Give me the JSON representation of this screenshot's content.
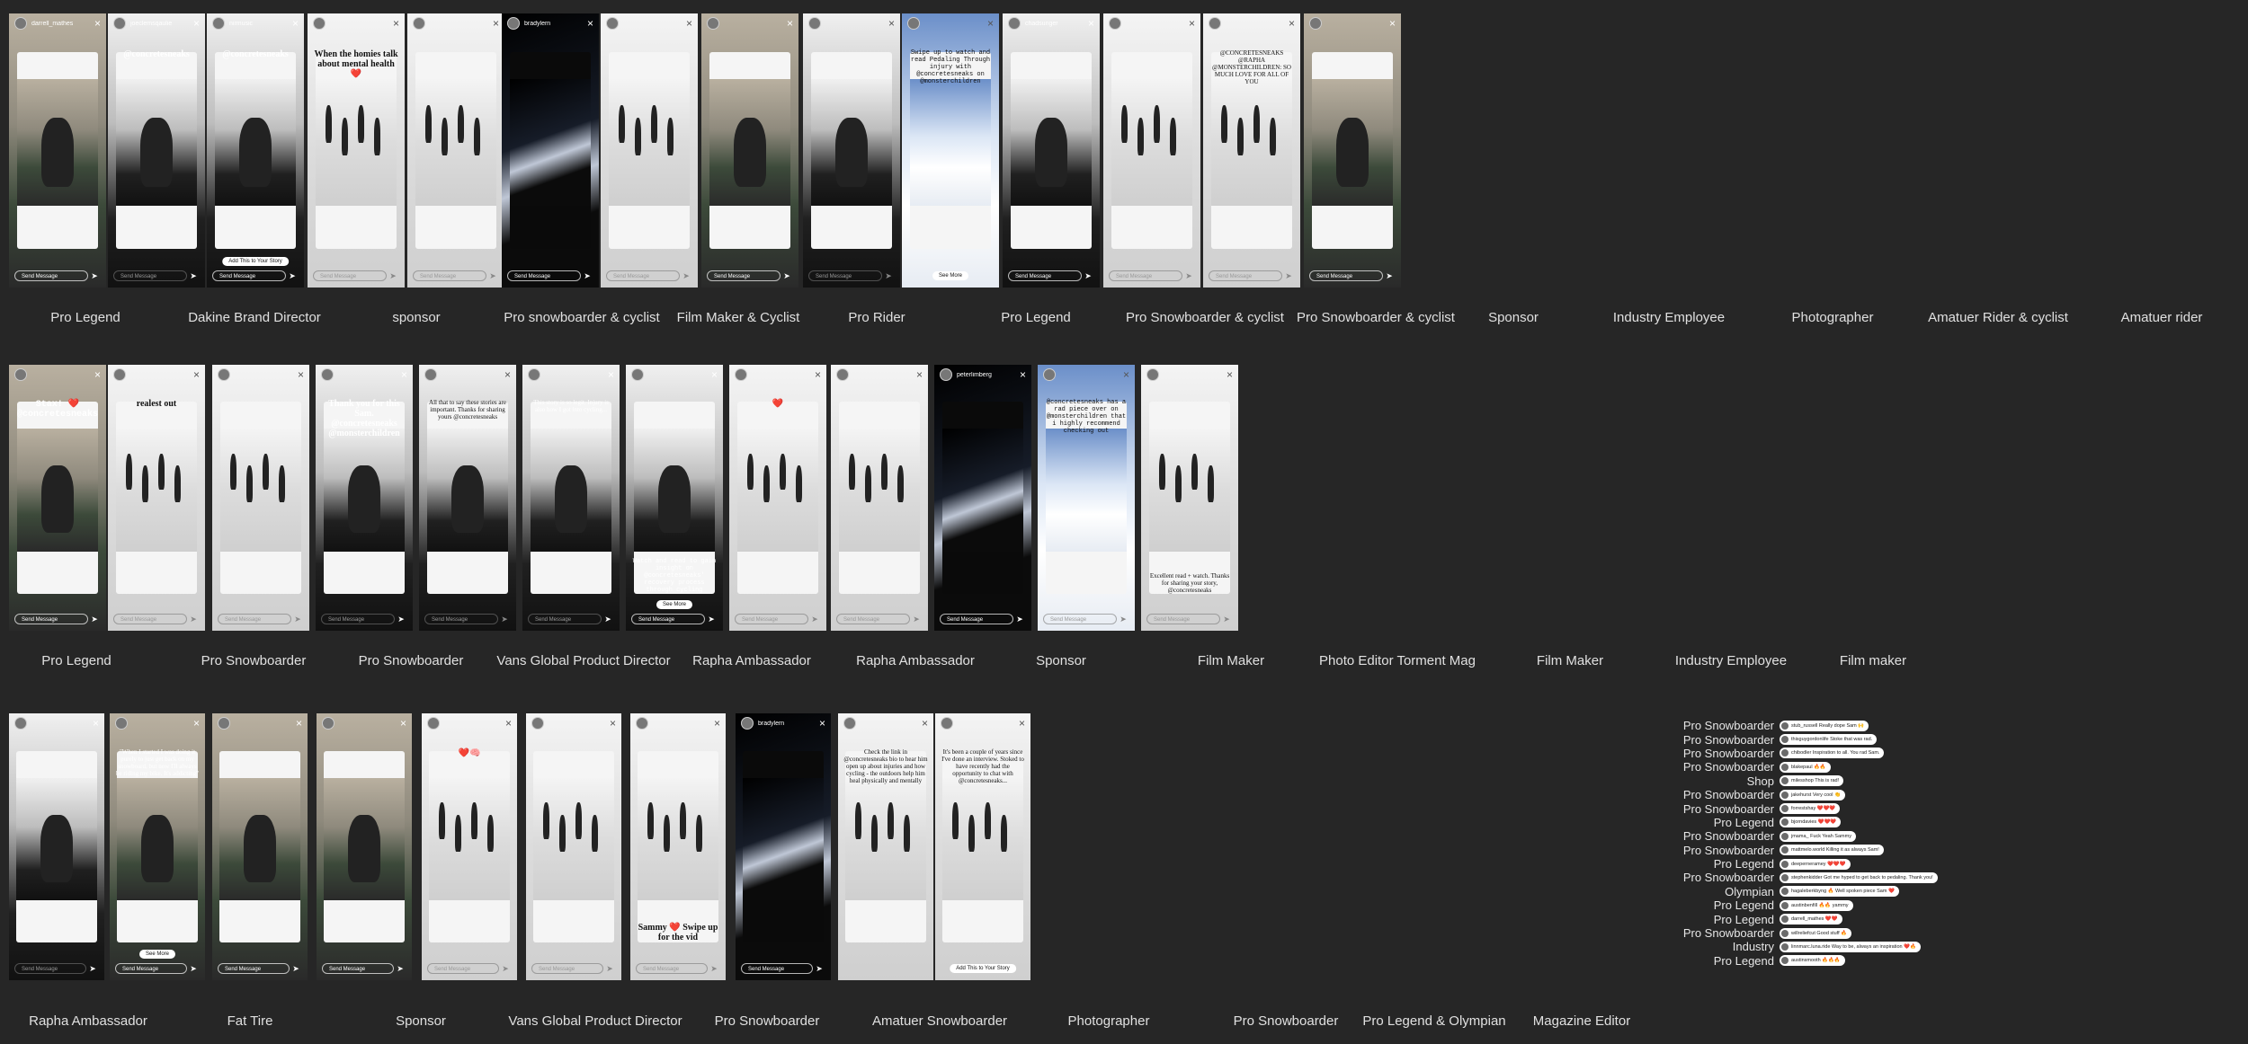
{
  "rows": [
    {
      "stories": [
        {
          "user": "darrell_mathes",
          "style": "tan",
          "photo": "photo-rider",
          "caption": "",
          "send": "Send Message"
        },
        {
          "user": "joeclemsqaulie",
          "style": "grey",
          "photo": "photo-bw",
          "caption": "@concretesneaks",
          "send": "Send Message"
        },
        {
          "user": "nirmusic",
          "style": "dark",
          "photo": "photo-bw",
          "caption": "@concretesneaks",
          "send": "Send Message",
          "btn": "Add This to Your Story"
        },
        {
          "user": "",
          "style": "light",
          "photo": "photo-snow",
          "caption": "When the homies talk about mental health ❤️",
          "send": "Send Message"
        },
        {
          "user": "",
          "style": "light",
          "photo": "photo-snow",
          "caption": "",
          "send": "Send Message"
        },
        {
          "user": "bradylern",
          "style": "dark",
          "photo": "photo-black",
          "caption": "",
          "send": "Send Message"
        },
        {
          "user": "",
          "style": "light",
          "photo": "photo-snow",
          "caption": "",
          "send": "Send Message"
        },
        {
          "user": "",
          "style": "tan",
          "photo": "photo-rider",
          "caption": "",
          "send": "Send Message"
        },
        {
          "user": "",
          "style": "light",
          "photo": "photo-bw",
          "caption": "",
          "send": "Send Message"
        },
        {
          "user": "",
          "style": "light",
          "photo": "photo-snowboard",
          "caption": "Swipe up to watch and read Pedaling Through injury with @concretesneaks on @monsterchildren",
          "send": "",
          "btn": "See More"
        },
        {
          "user": "chadsunger",
          "style": "dark",
          "photo": "photo-bw",
          "caption": "",
          "send": "Send Message"
        },
        {
          "user": "",
          "style": "light",
          "photo": "photo-snow",
          "caption": "",
          "send": "Send Message"
        },
        {
          "user": "",
          "style": "light",
          "photo": "photo-snow",
          "caption": "@CONCRETESNEAKS @RAPHA @MONSTERCHILDREN: SO MUCH LOVE FOR ALL OF YOU",
          "send": "Send Message"
        },
        {
          "user": "",
          "style": "tan",
          "photo": "photo-rider",
          "caption": "",
          "send": "Send Message"
        }
      ],
      "labels": [
        "Pro Legend",
        "Dakine Brand Director",
        "sponsor",
        "Pro snowboarder & cyclist",
        "Film Maker & Cyclist",
        "Pro Rider",
        "Pro Legend",
        "Pro Snowboarder & cyclist",
        "Pro Snowboarder & cyclist",
        "Sponsor",
        "Industry Employee",
        "Photographer",
        "Amatuer Rider & cyclist",
        "Amatuer rider"
      ]
    },
    {
      "stories": [
        {
          "user": "",
          "style": "tan",
          "photo": "photo-rider",
          "caption": "Stax! ❤️ @concretesneaks",
          "send": "Send Message"
        },
        {
          "user": "",
          "style": "light",
          "photo": "photo-snow",
          "caption": "realest out",
          "send": "Send Message"
        },
        {
          "user": "",
          "style": "light",
          "photo": "photo-snow",
          "caption": "",
          "send": "Send Message"
        },
        {
          "user": "",
          "style": "grey",
          "photo": "photo-bw",
          "caption": "Thank you for this Sam. @concretesneaks @monsterchildren",
          "send": "Send Message"
        },
        {
          "user": "",
          "style": "light",
          "photo": "photo-bw",
          "caption": "All that to say these stories are important. Thanks for sharing yours @concretesneaks",
          "send": "Send Message"
        },
        {
          "user": "",
          "style": "grey",
          "photo": "photo-bw",
          "caption": "This story is so legit. Injury is also how I got into cycling...",
          "send": "Send Message"
        },
        {
          "user": "",
          "style": "dark",
          "photo": "photo-bw",
          "caption": "Watch and read to gain insight on @concretesneaks' recovery process through cycling",
          "send": "Send Message",
          "btn": "See More"
        },
        {
          "user": "",
          "style": "light",
          "photo": "photo-snow",
          "caption": "❤️",
          "send": "Send Message"
        },
        {
          "user": "",
          "style": "light",
          "photo": "photo-snow",
          "caption": "",
          "send": "Send Message"
        },
        {
          "user": "peterlimberg",
          "style": "dark",
          "photo": "photo-black",
          "caption": "",
          "send": "Send Message"
        },
        {
          "user": "",
          "style": "light",
          "photo": "photo-snowboard",
          "caption": "@concretesneaks has a rad piece over on @monsterchildren that i highly recommend checking out",
          "send": "Send Message"
        },
        {
          "user": "",
          "style": "light",
          "photo": "photo-snow",
          "caption": "Excellent read + watch. Thanks for sharing your story, @concretesneaks",
          "send": "Send Message"
        }
      ],
      "labels": [
        "Pro Legend",
        "Pro Snowboarder",
        "Pro Snowboarder",
        "Vans Global Product Director",
        "Rapha Ambassador",
        "Rapha Ambassador",
        "Sponsor",
        "Film Maker",
        "Photo Editor Torment Mag",
        "Film Maker",
        "Industry Employee",
        "Film maker"
      ]
    },
    {
      "stories": [
        {
          "user": "",
          "style": "grey",
          "photo": "photo-bw",
          "caption": "",
          "send": "Send Message"
        },
        {
          "user": "",
          "style": "tan",
          "photo": "photo-rider",
          "caption": "\"When I started I was doing it purely to just get back on my snowboard, but now I'll always be riding my bike. It's addicting\"",
          "send": "Send Message",
          "btn": "See More"
        },
        {
          "user": "",
          "style": "tan",
          "photo": "photo-rider",
          "caption": "",
          "send": "Send Message"
        },
        {
          "user": "",
          "style": "tan",
          "photo": "photo-rider",
          "caption": "",
          "send": "Send Message"
        },
        {
          "user": "",
          "style": "light",
          "photo": "photo-snow",
          "caption": "❤️🧠",
          "send": "Send Message"
        },
        {
          "user": "",
          "style": "light",
          "photo": "photo-snow",
          "caption": "",
          "send": "Send Message"
        },
        {
          "user": "",
          "style": "light",
          "photo": "photo-snow",
          "caption": "Sammy ❤️ Swipe up for the vid",
          "send": "Send Message"
        },
        {
          "user": "bradylern",
          "style": "dark",
          "photo": "photo-black",
          "caption": "",
          "send": "Send Message"
        },
        {
          "user": "",
          "style": "light",
          "photo": "photo-snow",
          "caption": "Check the link in @concretesneaks bio to hear him open up about injuries and how cycling - the outdoors help him heal physically and mentally",
          "send": ""
        },
        {
          "user": "",
          "style": "light",
          "photo": "photo-snow",
          "caption": "It's been a couple of years since I've done an interview. Stoked to have recently had the opportunity to chat with @concretesneaks...",
          "send": "",
          "btn": "Add This to Your Story"
        }
      ],
      "labels": [
        "Rapha Ambassador",
        "Fat Tire",
        "Sponsor",
        "Vans Global Product Director",
        "Pro Snowboarder",
        "Amatuer Snowboarder",
        "Photographer",
        "Pro Snowboarder",
        "Pro Legend & Olympian",
        "Magazine Editor"
      ]
    }
  ],
  "comments": [
    {
      "role": "Pro Snowboarder",
      "text": "stub_russell Really dope Sam 🙌"
    },
    {
      "role": "Pro Snowboarder",
      "text": "thisguygordonlife Stoke that was rad."
    },
    {
      "role": "Pro Snowboarder",
      "text": "chibodler Inspiration to all. You rad Sam."
    },
    {
      "role": "Pro Snowboarder",
      "text": "blakepaul 🔥🔥"
    },
    {
      "role": "Shop",
      "text": "milesshop This is rad!"
    },
    {
      "role": "Pro Snowboarder",
      "text": "jakehurst Very cool 👏"
    },
    {
      "role": "Pro Snowboarder",
      "text": "forrestshay ❤️❤️❤️"
    },
    {
      "role": "Pro Legend",
      "text": "bjorndavies ❤️❤️❤️"
    },
    {
      "role": "Pro Snowboarder",
      "text": "jmama_ Fuck Yeah Sammy"
    },
    {
      "role": "Pro Snowboarder",
      "text": "mattmelo.world Killing it as always Sam!"
    },
    {
      "role": "Pro Legend",
      "text": "deeperneramey ❤️❤️❤️"
    },
    {
      "role": "Pro Snowboarder",
      "text": "stephenkidder Got me hyped to get back to pedaling. Thank you!"
    },
    {
      "role": "Olympian",
      "text": "hagaleberkbyng 🔥 Well spoken piece Sam ❤️"
    },
    {
      "role": "Pro Legend",
      "text": "austinbenfill 🔥🔥 yammy"
    },
    {
      "role": "Pro Legend",
      "text": "darrell_mathes ❤️❤️"
    },
    {
      "role": "Pro Snowboarder",
      "text": "willreliefcut Good stuff 🔥"
    },
    {
      "role": "Industry",
      "text": "linnmarc.luna.ride Way to be, always an inspiration ❤️🔥"
    },
    {
      "role": "Pro Legend",
      "text": "austinsmooth 🔥🔥🔥"
    }
  ]
}
